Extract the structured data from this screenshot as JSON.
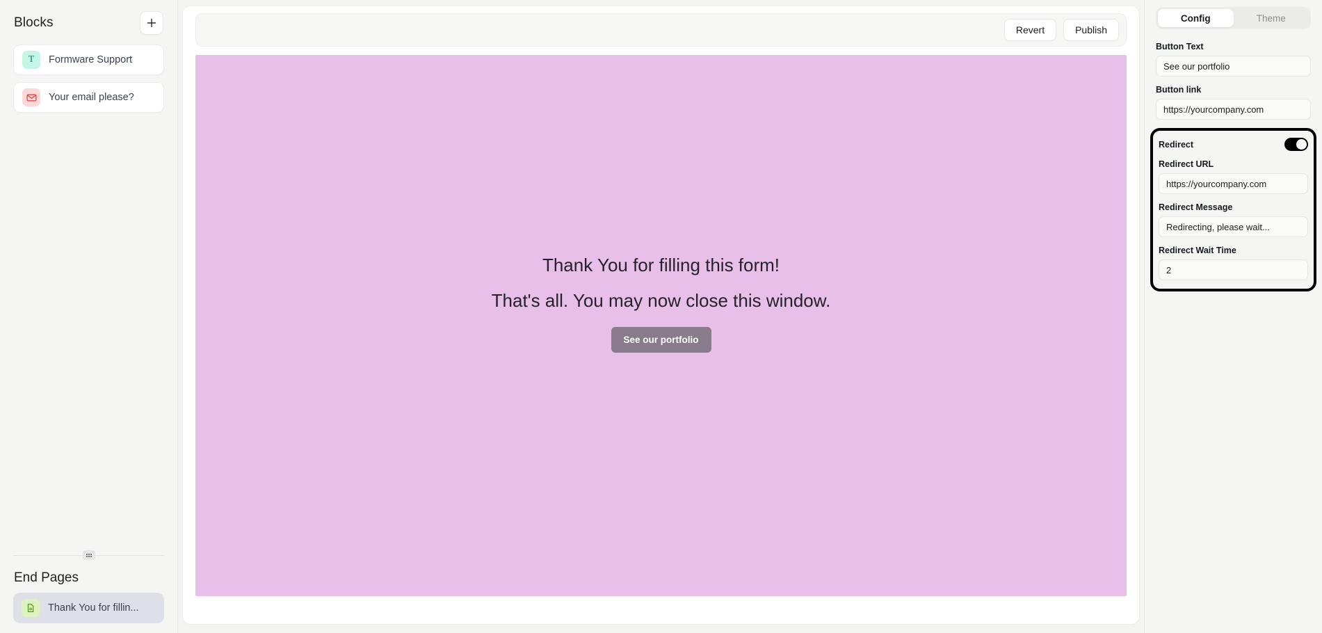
{
  "sidebar": {
    "blocks_title": "Blocks",
    "add_button_icon": "plus-icon",
    "blocks": [
      {
        "label": "Formware Support",
        "icon": "text-block-icon",
        "glyph": "T"
      },
      {
        "label": "Your email please?",
        "icon": "email-block-icon",
        "glyph": "envelope"
      }
    ],
    "divider_handle_icon": "drag-handle-icon",
    "end_pages_title": "End Pages",
    "end_pages": [
      {
        "label": "Thank You for fillin...",
        "icon": "document-icon"
      }
    ]
  },
  "toolbar": {
    "revert_label": "Revert",
    "publish_label": "Publish"
  },
  "canvas": {
    "background_color": "#e7bfe9",
    "heading": "Thank You for filling this form!",
    "subheading": "That's all. You may now close this window.",
    "cta_label": "See our portfolio",
    "cta_color": "#8a7b8c"
  },
  "right_panel": {
    "tabs": [
      {
        "label": "Config",
        "active": true
      },
      {
        "label": "Theme",
        "active": false
      }
    ],
    "fields": [
      {
        "label": "Button Text",
        "value": "See our portfolio"
      },
      {
        "label": "Button link",
        "value": "https://yourcompany.com"
      }
    ],
    "redirect": {
      "label": "Redirect",
      "toggle_on": true,
      "url_label": "Redirect URL",
      "url_value": "https://yourcompany.com",
      "message_label": "Redirect Message",
      "message_value": "Redirecting, please wait...",
      "wait_label": "Redirect Wait Time",
      "wait_value": "2",
      "highlight_color": "#000000"
    }
  }
}
